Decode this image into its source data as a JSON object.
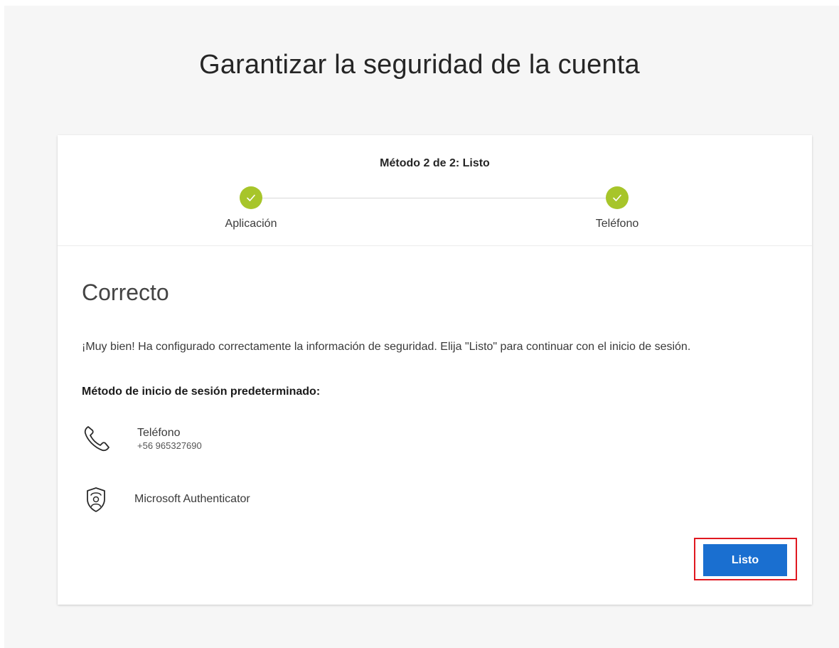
{
  "page": {
    "title": "Garantizar la seguridad de la cuenta"
  },
  "stepper": {
    "caption": "Método 2 de 2: Listo",
    "steps": [
      {
        "label": "Aplicación",
        "status": "complete"
      },
      {
        "label": "Teléfono",
        "status": "complete"
      }
    ],
    "complete_color": "#a7c52a"
  },
  "content": {
    "title": "Correcto",
    "message": "¡Muy bien! Ha configurado correctamente la información de seguridad. Elija \"Listo\" para continuar con el inicio de sesión.",
    "default_method_label": "Método de inicio de sesión predeterminado:",
    "methods": [
      {
        "icon": "phone-icon",
        "name": "Teléfono",
        "detail": "+56 965327690"
      },
      {
        "icon": "authenticator-icon",
        "name": "Microsoft Authenticator"
      }
    ]
  },
  "actions": {
    "done_label": "Listo",
    "done_color": "#1a6fd0",
    "highlight_color": "#e01820"
  }
}
